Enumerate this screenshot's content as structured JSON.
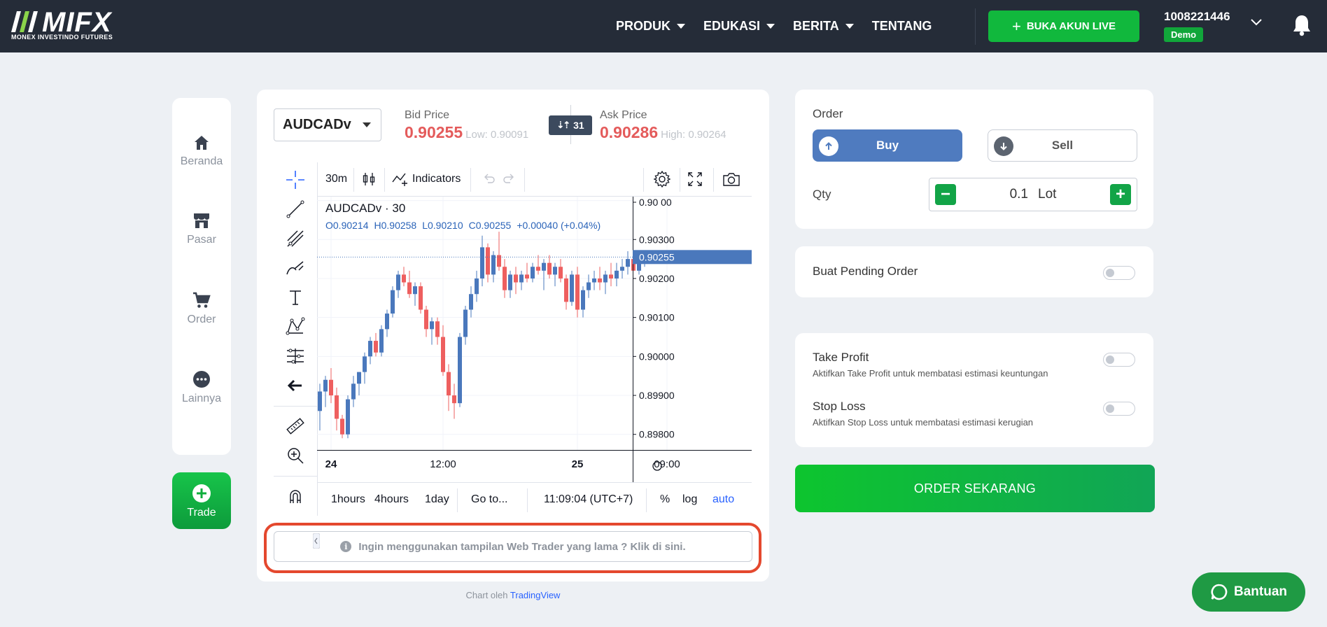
{
  "brand": {
    "logo_text": "MIFX",
    "logo_sub": "MONEX INVESTINDO FUTURES"
  },
  "nav": {
    "items": [
      "PRODUK",
      "EDUKASI",
      "BERITA",
      "TENTANG"
    ],
    "live_button": "BUKA AKUN LIVE",
    "account_number": "1008221446",
    "account_type": "Demo"
  },
  "sidebar": {
    "items": [
      "Beranda",
      "Pasar",
      "Order",
      "Lainnya"
    ],
    "trade": "Trade"
  },
  "instrument": {
    "symbol": "AUDCADv",
    "bid_label": "Bid Price",
    "bid": "0.90255",
    "low": "Low: 0.90091",
    "ask_label": "Ask Price",
    "ask": "0.90286",
    "high": "High: 0.90264",
    "spread": "31"
  },
  "chart_toolbar": {
    "interval": "30m",
    "indicators": "Indicators"
  },
  "chart_bottom": {
    "ranges": [
      "1hours",
      "4hours",
      "1day"
    ],
    "goto": "Go to...",
    "clock": "11:09:04 (UTC+7)",
    "percent": "%",
    "log": "log",
    "auto": "auto"
  },
  "chart_data": {
    "type": "candlestick",
    "title": "AUDCADv · 30",
    "legend": {
      "open": "O0.90214",
      "high": "H0.90258",
      "low": "L0.90210",
      "close": "C0.90255",
      "change": "+0.00040 (+0.04%)"
    },
    "ylim": [
      0.8976,
      0.9005
    ],
    "y_ticks": [
      "0.90 00",
      "0.90300",
      "0.90200",
      "0.90100",
      "0.90000",
      "0.89900",
      "0.89800"
    ],
    "y_tick_values": [
      0.904,
      0.903,
      0.902,
      0.901,
      0.9,
      0.899,
      0.898
    ],
    "x_ticks": [
      "24",
      "12:00",
      "25",
      "09:00"
    ],
    "x_tick_index": [
      2,
      22,
      46,
      62
    ],
    "last_price": "0.90255",
    "last_price_value": 0.90255,
    "candles": [
      [
        0.8986,
        0.8993,
        0.8981,
        0.8991
      ],
      [
        0.8991,
        0.8995,
        0.8987,
        0.8994
      ],
      [
        0.8994,
        0.8997,
        0.8988,
        0.899
      ],
      [
        0.899,
        0.8992,
        0.8981,
        0.8984
      ],
      [
        0.8984,
        0.8985,
        0.8979,
        0.898
      ],
      [
        0.898,
        0.899,
        0.8979,
        0.8989
      ],
      [
        0.8989,
        0.8995,
        0.8987,
        0.8993
      ],
      [
        0.8993,
        0.8996,
        0.899,
        0.8996
      ],
      [
        0.8996,
        0.9001,
        0.8993,
        0.9
      ],
      [
        0.9,
        0.9005,
        0.8998,
        0.9004
      ],
      [
        0.9004,
        0.9006,
        0.9,
        0.9001
      ],
      [
        0.9001,
        0.9008,
        0.9,
        0.9007
      ],
      [
        0.9007,
        0.9012,
        0.9005,
        0.9011
      ],
      [
        0.9011,
        0.9018,
        0.901,
        0.9017
      ],
      [
        0.9017,
        0.9022,
        0.9015,
        0.9021
      ],
      [
        0.9021,
        0.9023,
        0.9018,
        0.9019
      ],
      [
        0.9019,
        0.9022,
        0.9015,
        0.9016
      ],
      [
        0.9016,
        0.9019,
        0.9013,
        0.9018
      ],
      [
        0.9018,
        0.9019,
        0.9011,
        0.9012
      ],
      [
        0.9012,
        0.9013,
        0.9005,
        0.9007
      ],
      [
        0.9007,
        0.901,
        0.9003,
        0.9009
      ],
      [
        0.9009,
        0.901,
        0.9003,
        0.9005
      ],
      [
        0.9005,
        0.9008,
        0.8995,
        0.8996
      ],
      [
        0.8996,
        0.8998,
        0.8986,
        0.899
      ],
      [
        0.899,
        0.8993,
        0.8984,
        0.8988
      ],
      [
        0.8988,
        0.9006,
        0.8987,
        0.9005
      ],
      [
        0.9005,
        0.9013,
        0.9003,
        0.9012
      ],
      [
        0.9012,
        0.9018,
        0.901,
        0.9016
      ],
      [
        0.9016,
        0.9022,
        0.9014,
        0.902
      ],
      [
        0.902,
        0.9031,
        0.9018,
        0.9028
      ],
      [
        0.9028,
        0.9029,
        0.9019,
        0.9021
      ],
      [
        0.9021,
        0.9027,
        0.9019,
        0.9026
      ],
      [
        0.9026,
        0.9032,
        0.9022,
        0.9023
      ],
      [
        0.9023,
        0.9025,
        0.9015,
        0.9017
      ],
      [
        0.9017,
        0.9022,
        0.9015,
        0.9021
      ],
      [
        0.9021,
        0.9023,
        0.9016,
        0.9019
      ],
      [
        0.9019,
        0.9022,
        0.9017,
        0.9021
      ],
      [
        0.9021,
        0.9024,
        0.9019,
        0.902
      ],
      [
        0.902,
        0.9024,
        0.9019,
        0.9023
      ],
      [
        0.9023,
        0.9026,
        0.9021,
        0.9022
      ],
      [
        0.9022,
        0.9025,
        0.9017,
        0.9024
      ],
      [
        0.9024,
        0.9026,
        0.902,
        0.9021
      ],
      [
        0.9021,
        0.9024,
        0.9018,
        0.9023
      ],
      [
        0.9023,
        0.9025,
        0.9019,
        0.902
      ],
      [
        0.902,
        0.9021,
        0.9012,
        0.9014
      ],
      [
        0.9014,
        0.9022,
        0.9013,
        0.9021
      ],
      [
        0.9021,
        0.9023,
        0.901,
        0.9012
      ],
      [
        0.9012,
        0.9018,
        0.901,
        0.9017
      ],
      [
        0.9017,
        0.9021,
        0.9015,
        0.9019
      ],
      [
        0.9019,
        0.9022,
        0.9017,
        0.902
      ],
      [
        0.902,
        0.9023,
        0.9017,
        0.9019
      ],
      [
        0.9019,
        0.9022,
        0.9016,
        0.9021
      ],
      [
        0.9021,
        0.9024,
        0.9018,
        0.902
      ],
      [
        0.902,
        0.9024,
        0.9018,
        0.9022
      ],
      [
        0.9022,
        0.9025,
        0.902,
        0.9023
      ],
      [
        0.9023,
        0.9027,
        0.9021,
        0.9025
      ],
      [
        0.9025,
        0.9026,
        0.9022,
        0.9022
      ],
      [
        0.9022,
        0.9025,
        0.9021,
        0.9024
      ],
      [
        0.9024,
        0.9026,
        0.9023,
        0.9025
      ]
    ]
  },
  "old_ui_notice": "Ingin menggunakan tampilan Web Trader yang lama ? Klik di sini.",
  "credit": {
    "prefix": "Chart oleh",
    "link": "TradingView"
  },
  "order_panel": {
    "title": "Order",
    "buy": "Buy",
    "sell": "Sell",
    "qty_label": "Qty",
    "qty_value": "0.1",
    "qty_unit": "Lot"
  },
  "pending": {
    "label": "Buat Pending Order"
  },
  "take_profit": {
    "title": "Take Profit",
    "desc": "Aktifkan Take Profit untuk membatasi estimasi keuntungan"
  },
  "stop_loss": {
    "title": "Stop Loss",
    "desc": "Aktifkan Stop Loss untuk membatasi estimasi kerugian"
  },
  "order_now": "ORDER SEKARANG",
  "help": "Bantuan",
  "colors": {
    "navbar": "#252c38",
    "up": "#4a78bc",
    "down": "#ee5f5f",
    "primary_green": "#11b83d",
    "buy": "#4f7bbf"
  }
}
